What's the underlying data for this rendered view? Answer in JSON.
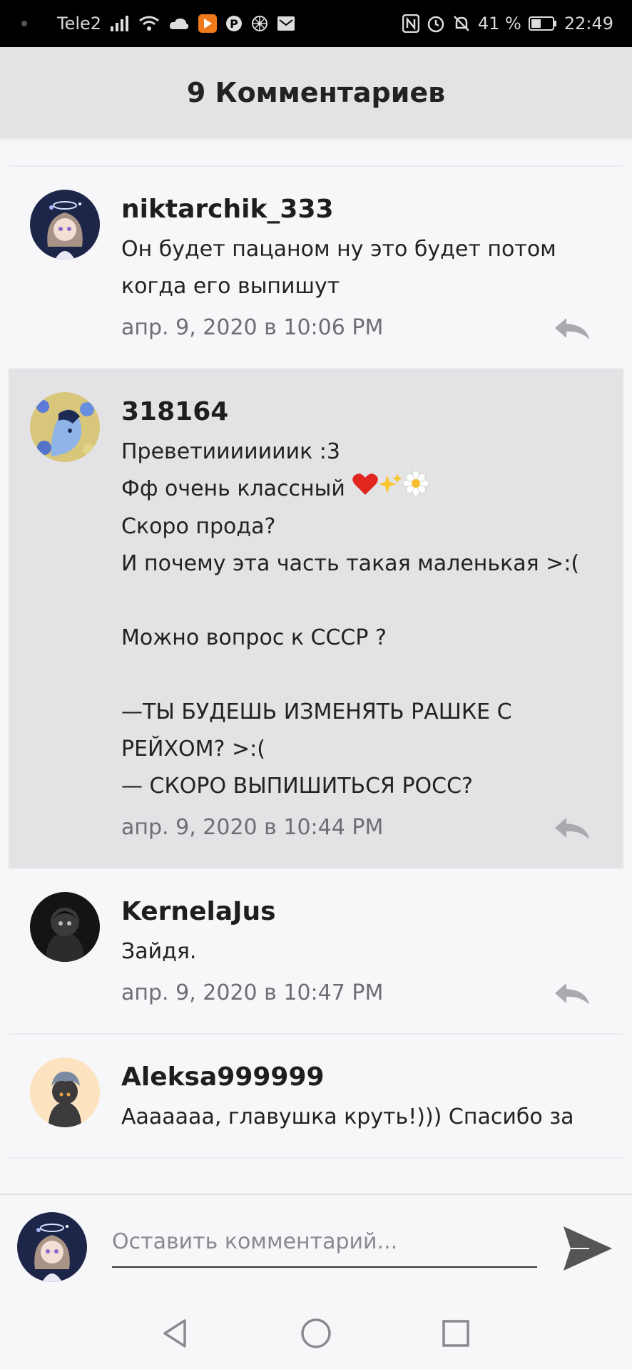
{
  "status_bar": {
    "carrier": "Tele2",
    "battery": "41 %",
    "time": "22:49",
    "icons": [
      "signal-icon",
      "wifi-icon",
      "cloud-icon",
      "play-icon",
      "pinterest-icon",
      "flower-icon",
      "mail-icon",
      "nfc-icon",
      "alarm-icon",
      "mute-icon",
      "battery-icon"
    ]
  },
  "header": {
    "title": "9 Комментариев"
  },
  "comments": [
    {
      "author": "niktarchik_333",
      "text": "Он будет пацаном ну это будет потом когда его выпишут",
      "date": "апр. 9, 2020 в 10:06 PM"
    },
    {
      "author": "318164",
      "text_line1": "Преветииииииик :3",
      "text_line2": "Фф очень классный",
      "emojis": [
        "heart-emoji",
        "sparkles-emoji",
        "daisy-emoji"
      ],
      "text_rest": "Скоро прода?\nИ почему эта часть такая маленькая >:(\n\nМожно вопрос к СССР ?\n\n—ТЫ БУДЕШЬ ИЗМЕНЯТЬ РАШКЕ С РЕЙХОМ? >:(\n— СКОРО ВЫПИШИТЬСЯ РОСС?",
      "date": "апр. 9, 2020 в 10:44 PM"
    },
    {
      "author": "KernelaJus",
      "text": "Зайдя.",
      "date": "апр. 9, 2020 в 10:47 PM"
    },
    {
      "author": "Aleksa999999",
      "text": "Ааааааа, главушка круть!))) Спасибо за"
    }
  ],
  "compose": {
    "placeholder": "Оставить комментарий..."
  },
  "colors": {
    "highlight": "#e3e2e5",
    "background": "#f7f6f9",
    "date": "#6e6e73",
    "battery_accent": "#f07a1a"
  }
}
